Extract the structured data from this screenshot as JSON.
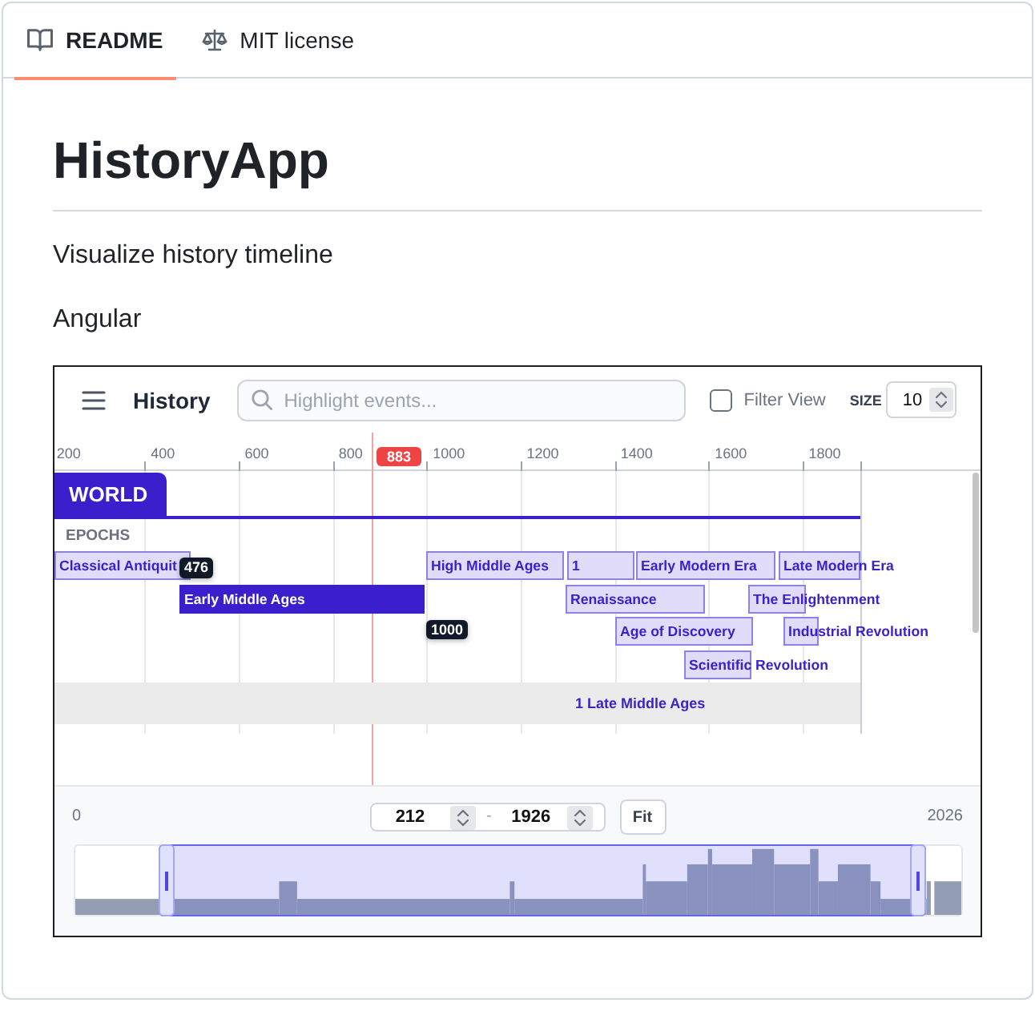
{
  "tabs": [
    {
      "label": "README",
      "kind": "readme",
      "selected": true
    },
    {
      "label": "MIT license",
      "kind": "license",
      "selected": false
    }
  ],
  "readme": {
    "title": "HistoryApp",
    "paragraphs": [
      "Visualize history timeline",
      "Angular"
    ]
  },
  "app": {
    "header": {
      "title": "History",
      "search": {
        "placeholder": "Highlight events..."
      },
      "filter": {
        "label": "Filter View",
        "checked": false
      },
      "size": {
        "label": "SIZE",
        "value": "10"
      }
    },
    "ruler": {
      "ticks": [
        "200",
        "400",
        "600",
        "800",
        "1000",
        "1200",
        "1400",
        "1600",
        "1800"
      ]
    },
    "cursor": {
      "label": "883"
    },
    "group_tab": {
      "label": "WORLD",
      "selected": true
    },
    "section_label": "EPOCHS",
    "events": [
      {
        "label": "Classical Antiquit",
        "selected": false
      },
      {
        "label": "High Middle Ages",
        "selected": false
      },
      {
        "label": "1",
        "selected": false
      },
      {
        "label": "Early Modern Era",
        "selected": false
      },
      {
        "label": "Late Modern Era",
        "selected": false
      },
      {
        "label": "Early Middle Ages",
        "selected": true
      },
      {
        "label": "Renaissance",
        "selected": false
      },
      {
        "label": "The Enlightenment",
        "selected": false
      },
      {
        "label": "Age of Discovery",
        "selected": false
      },
      {
        "label": "Industrial Revolution",
        "selected": false
      },
      {
        "label": "Scientific Revolution",
        "selected": false
      }
    ],
    "selected_event_years": [
      "476",
      "1000"
    ],
    "collapsed_row": {
      "label": "1 Late Middle Ages"
    },
    "range": {
      "min_label": "0",
      "start": "212",
      "separator": "-",
      "end": "1926",
      "fit_button": "Fit",
      "max_label": "2026"
    }
  }
}
